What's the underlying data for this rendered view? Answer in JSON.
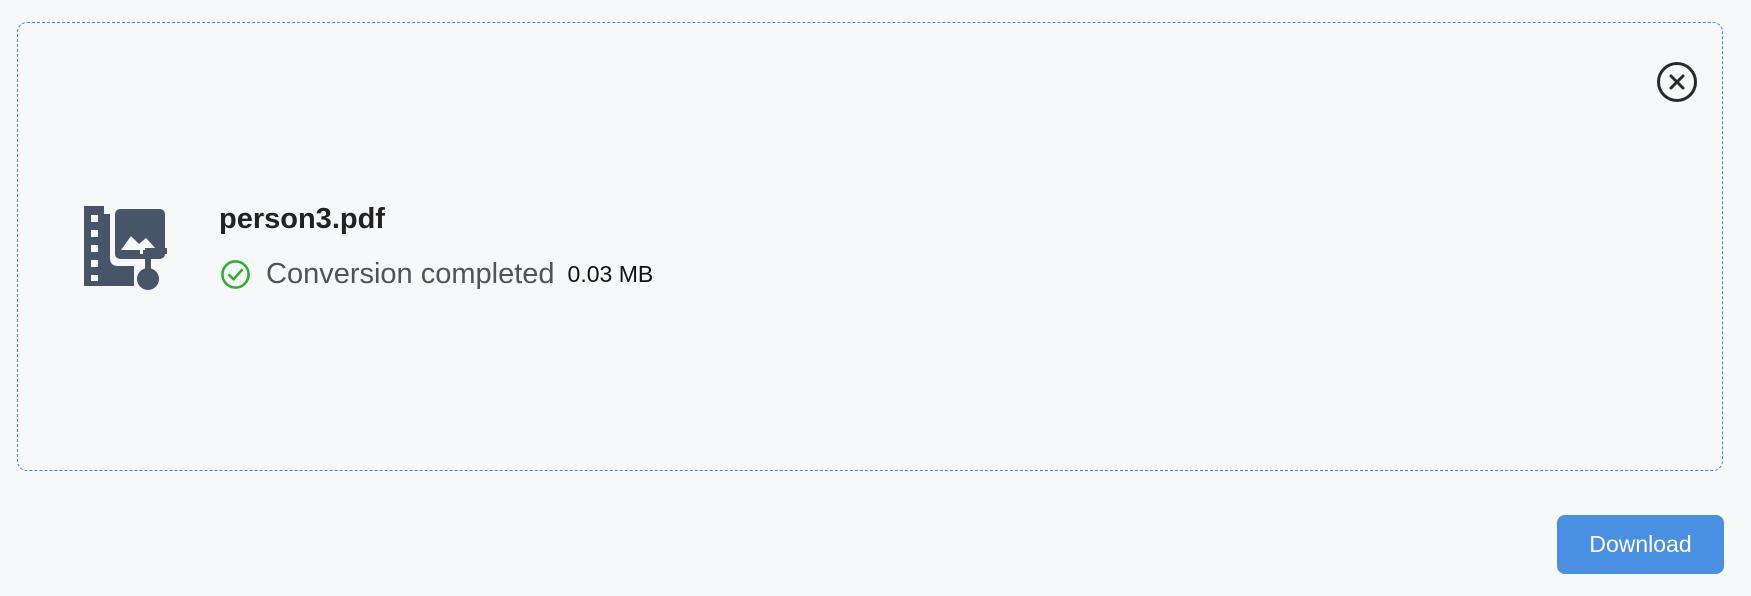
{
  "file": {
    "name": "person3.pdf",
    "status": "Conversion completed",
    "size": "0.03 MB",
    "icon": "photo-film-music-icon",
    "status_icon": "check-circle-icon"
  },
  "actions": {
    "close_icon": "close-circle-icon",
    "download_label": "Download"
  },
  "colors": {
    "accent": "#4a90e2",
    "card_border": "#4a86c8",
    "success": "#2bb02b",
    "icon": "#475569",
    "background": "#f7f8fa"
  }
}
